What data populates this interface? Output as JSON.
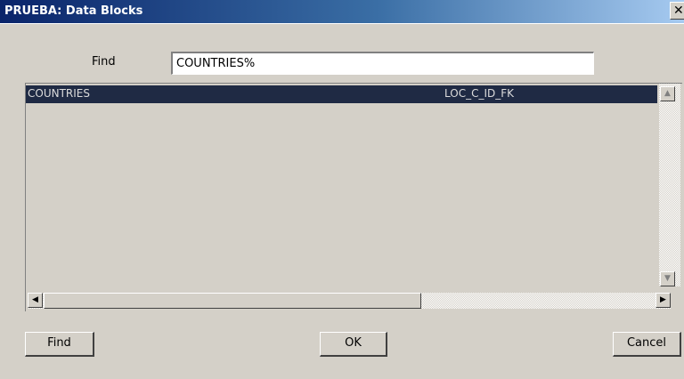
{
  "window": {
    "title": "PRUEBA: Data Blocks",
    "close_glyph": "✕"
  },
  "search": {
    "label": "Find",
    "value": "COUNTRIES%"
  },
  "grid": {
    "columns": [
      "COUNTRIES",
      "LOC_C_ID_FK"
    ],
    "rows": []
  },
  "scroll": {
    "up": "▲",
    "down": "▼",
    "left": "◀",
    "right": "▶"
  },
  "buttons": {
    "find": "Find",
    "ok": "OK",
    "cancel": "Cancel"
  }
}
